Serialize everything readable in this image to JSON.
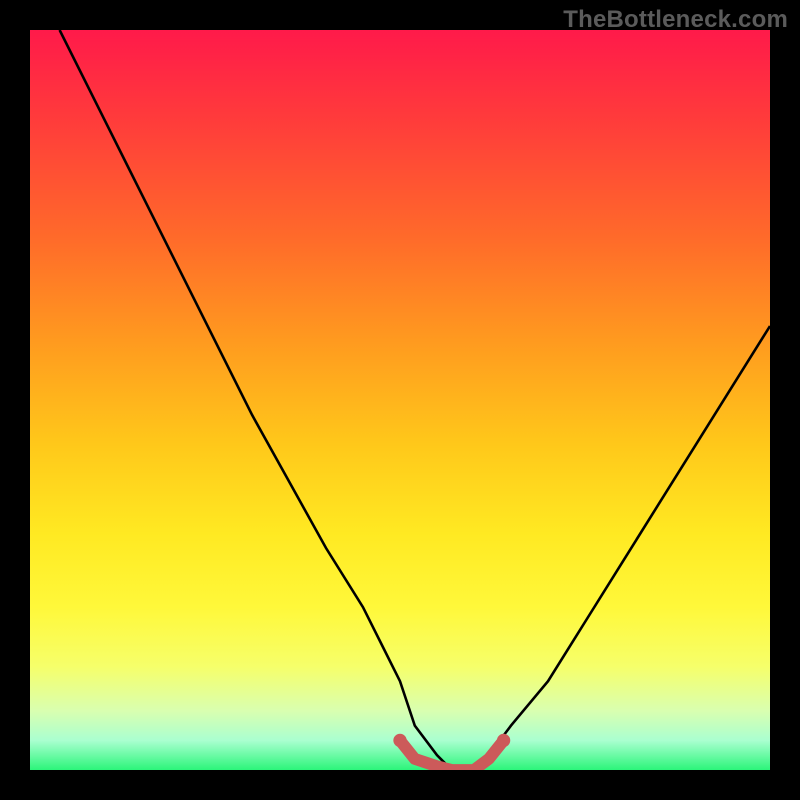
{
  "watermark": "TheBottleneck.com",
  "chart_data": {
    "type": "line",
    "title": "",
    "xlabel": "",
    "ylabel": "",
    "xlim": [
      0,
      100
    ],
    "ylim": [
      0,
      100
    ],
    "series": [
      {
        "name": "bottleneck-curve",
        "color": "#000000",
        "x": [
          4,
          10,
          15,
          20,
          25,
          30,
          35,
          40,
          45,
          50,
          52,
          55,
          57,
          60,
          62,
          65,
          70,
          75,
          80,
          85,
          90,
          95,
          100
        ],
        "y": [
          100,
          88,
          78,
          68,
          58,
          48,
          39,
          30,
          22,
          12,
          6,
          2,
          0,
          0,
          2,
          6,
          12,
          20,
          28,
          36,
          44,
          52,
          60
        ]
      },
      {
        "name": "highlight-segment",
        "color": "#cc5a5a",
        "x": [
          50,
          52,
          55,
          57,
          60,
          62,
          64
        ],
        "y": [
          4,
          1.5,
          0.5,
          0,
          0,
          1.5,
          4
        ]
      }
    ],
    "gradient_stops": [
      {
        "pos": 0,
        "color": "#ff1a4a"
      },
      {
        "pos": 12,
        "color": "#ff3b3b"
      },
      {
        "pos": 28,
        "color": "#ff6a2a"
      },
      {
        "pos": 42,
        "color": "#ff9a1f"
      },
      {
        "pos": 56,
        "color": "#ffc81a"
      },
      {
        "pos": 68,
        "color": "#ffe922"
      },
      {
        "pos": 78,
        "color": "#fff83a"
      },
      {
        "pos": 86,
        "color": "#f6ff6a"
      },
      {
        "pos": 92,
        "color": "#d9ffb0"
      },
      {
        "pos": 96,
        "color": "#aaffd0"
      },
      {
        "pos": 100,
        "color": "#2cf57a"
      }
    ]
  }
}
